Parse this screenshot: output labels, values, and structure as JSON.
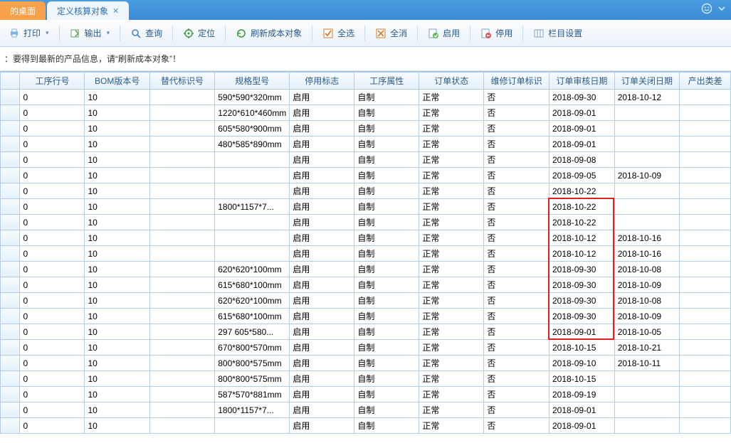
{
  "tabs": {
    "main": "的桌面",
    "active": "定义核算对象"
  },
  "toolbar": {
    "print": "打印",
    "export": "输出",
    "query": "查询",
    "locate": "定位",
    "refresh": "刷新成本对象",
    "selectall": "全选",
    "deselect": "全消",
    "enable": "启用",
    "disable": "停用",
    "columns": "栏目设置"
  },
  "hint": "：要得到最新的产品信息，请“刷新成本对象”！",
  "headers": [
    "工序行号",
    "BOM版本号",
    "替代标识号",
    "规格型号",
    "停用标志",
    "工序属性",
    "订单状态",
    "维修订单标识",
    "订单审核日期",
    "订单关闭日期",
    "产出类差"
  ],
  "rows": [
    {
      "a": "0",
      "b": "10",
      "c": "",
      "d": "590*590*320mm",
      "e": "启用",
      "f": "自制",
      "g": "正常",
      "h": "否",
      "i": "2018-09-30",
      "j": "2018-10-12"
    },
    {
      "a": "0",
      "b": "10",
      "c": "",
      "d": "1220*610*460mm",
      "e": "启用",
      "f": "自制",
      "g": "正常",
      "h": "否",
      "i": "2018-09-01",
      "j": ""
    },
    {
      "a": "0",
      "b": "10",
      "c": "",
      "d": "605*580*900mm",
      "e": "启用",
      "f": "自制",
      "g": "正常",
      "h": "否",
      "i": "2018-09-01",
      "j": ""
    },
    {
      "a": "0",
      "b": "10",
      "c": "",
      "d": "480*585*890mm",
      "e": "启用",
      "f": "自制",
      "g": "正常",
      "h": "否",
      "i": "2018-09-01",
      "j": ""
    },
    {
      "a": "0",
      "b": "10",
      "c": "",
      "d": "",
      "e": "启用",
      "f": "自制",
      "g": "正常",
      "h": "否",
      "i": "2018-09-08",
      "j": ""
    },
    {
      "a": "0",
      "b": "10",
      "c": "",
      "d": "",
      "e": "启用",
      "f": "自制",
      "g": "正常",
      "h": "否",
      "i": "2018-09-05",
      "j": "2018-10-09"
    },
    {
      "a": "0",
      "b": "10",
      "c": "",
      "d": "",
      "e": "启用",
      "f": "自制",
      "g": "正常",
      "h": "否",
      "i": "2018-10-22",
      "j": ""
    },
    {
      "a": "0",
      "b": "10",
      "c": "",
      "d": "1800*1157*7...",
      "e": "启用",
      "f": "自制",
      "g": "正常",
      "h": "否",
      "i": "2018-10-22",
      "j": ""
    },
    {
      "a": "0",
      "b": "10",
      "c": "",
      "d": "",
      "e": "启用",
      "f": "自制",
      "g": "正常",
      "h": "否",
      "i": "2018-10-22",
      "j": ""
    },
    {
      "a": "0",
      "b": "10",
      "c": "",
      "d": "",
      "e": "启用",
      "f": "自制",
      "g": "正常",
      "h": "否",
      "i": "2018-10-12",
      "j": "2018-10-16"
    },
    {
      "a": "0",
      "b": "10",
      "c": "",
      "d": "",
      "e": "启用",
      "f": "自制",
      "g": "正常",
      "h": "否",
      "i": "2018-10-12",
      "j": "2018-10-16"
    },
    {
      "a": "0",
      "b": "10",
      "c": "",
      "d": "620*620*100mm",
      "e": "启用",
      "f": "自制",
      "g": "正常",
      "h": "否",
      "i": "2018-09-30",
      "j": "2018-10-08"
    },
    {
      "a": "0",
      "b": "10",
      "c": "",
      "d": "615*680*100mm",
      "e": "启用",
      "f": "自制",
      "g": "正常",
      "h": "否",
      "i": "2018-09-30",
      "j": "2018-10-09"
    },
    {
      "a": "0",
      "b": "10",
      "c": "",
      "d": "620*620*100mm",
      "e": "启用",
      "f": "自制",
      "g": "正常",
      "h": "否",
      "i": "2018-09-30",
      "j": "2018-10-08"
    },
    {
      "a": "0",
      "b": "10",
      "c": "",
      "d": "615*680*100mm",
      "e": "启用",
      "f": "自制",
      "g": "正常",
      "h": "否",
      "i": "2018-09-30",
      "j": "2018-10-09"
    },
    {
      "a": "0",
      "b": "10",
      "c": "",
      "d": "297 605*580...",
      "e": "启用",
      "f": "自制",
      "g": "正常",
      "h": "否",
      "i": "2018-09-01",
      "j": "2018-10-05"
    },
    {
      "a": "0",
      "b": "10",
      "c": "",
      "d": "670*800*570mm",
      "e": "启用",
      "f": "自制",
      "g": "正常",
      "h": "否",
      "i": "2018-10-15",
      "j": "2018-10-21"
    },
    {
      "a": "0",
      "b": "10",
      "c": "",
      "d": "800*800*575mm",
      "e": "启用",
      "f": "自制",
      "g": "正常",
      "h": "否",
      "i": "2018-09-10",
      "j": "2018-10-11"
    },
    {
      "a": "0",
      "b": "10",
      "c": "",
      "d": "800*800*575mm",
      "e": "启用",
      "f": "自制",
      "g": "正常",
      "h": "否",
      "i": "2018-10-15",
      "j": ""
    },
    {
      "a": "0",
      "b": "10",
      "c": "",
      "d": "587*570*881mm",
      "e": "启用",
      "f": "自制",
      "g": "正常",
      "h": "否",
      "i": "2018-09-19",
      "j": ""
    },
    {
      "a": "0",
      "b": "10",
      "c": "",
      "d": "1800*1157*7...",
      "e": "启用",
      "f": "自制",
      "g": "正常",
      "h": "否",
      "i": "2018-09-01",
      "j": ""
    },
    {
      "a": "0",
      "b": "10",
      "c": "",
      "d": "",
      "e": "启用",
      "f": "自制",
      "g": "正常",
      "h": "否",
      "i": "2018-09-01",
      "j": ""
    }
  ],
  "annotation": {
    "col": 8,
    "rowStart": 7,
    "rowEnd": 15
  }
}
